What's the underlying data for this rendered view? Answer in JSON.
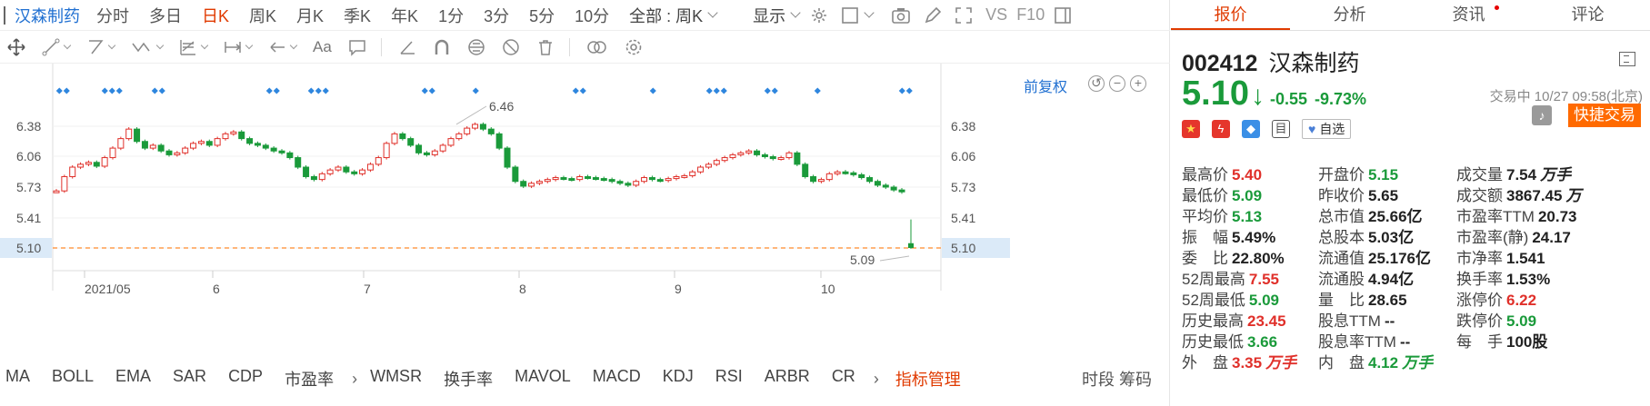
{
  "period_bar": {
    "stock_name": "汉森制药",
    "periods": [
      "分时",
      "多日",
      "日K",
      "周K",
      "月K",
      "季K",
      "年K",
      "1分",
      "3分",
      "5分",
      "10分"
    ],
    "active_period": "日K",
    "all_select": "全部 : 周K",
    "display_select": "显示",
    "vs_label": "VS",
    "f10_label": "F10"
  },
  "toolbar": {
    "text_tool": "Aa"
  },
  "chart": {
    "fuquan": "前复权",
    "y_ticks": [
      "6.38",
      "6.06",
      "5.73",
      "5.41",
      "5.10"
    ],
    "x_labels": [
      "2021/05",
      "6",
      "7",
      "8",
      "9",
      "10"
    ],
    "high_label": "6.46",
    "low_label": "5.09",
    "current_price_label": "5.10",
    "colors": {
      "up": "#e0302a",
      "down": "#1a9a3a",
      "ref_line": "#ff8a2a",
      "marker": "#2e86de"
    }
  },
  "indicators": {
    "left_group": [
      "MA",
      "BOLL",
      "EMA",
      "SAR",
      "CDP",
      "市盈率"
    ],
    "right_group": [
      "WMSR",
      "换手率",
      "MAVOL",
      "MACD",
      "KDJ",
      "RSI",
      "ARBR",
      "CR"
    ],
    "manage": "指标管理",
    "right_tail": "时段 筹码"
  },
  "tabs": [
    "报价",
    "分析",
    "资讯",
    "评论"
  ],
  "active_tab": "报价",
  "quote": {
    "code": "002412",
    "name": "汉森制药",
    "price": "5.10",
    "change": "-0.55",
    "change_pct": "-9.73%",
    "trade_time": "交易中 10/27 09:58(北京)",
    "fav_label": "自选",
    "fast_trade": "快捷交易",
    "doc_badge": "目"
  },
  "stats": [
    [
      {
        "label": "最高价",
        "value": "5.40",
        "color": "red"
      },
      {
        "label": "开盘价",
        "value": "5.15",
        "color": "green"
      },
      {
        "label": "成交量",
        "value": "7.54",
        "unit": "万手"
      }
    ],
    [
      {
        "label": "最低价",
        "value": "5.09",
        "color": "green"
      },
      {
        "label": "昨收价",
        "value": "5.65"
      },
      {
        "label": "成交额",
        "value": "3867.45",
        "unit": "万"
      }
    ],
    [
      {
        "label": "平均价",
        "value": "5.13",
        "color": "green"
      },
      {
        "label": "总市值",
        "value": "25.66亿"
      },
      {
        "label": "市盈率TTM",
        "value": "20.73"
      }
    ],
    [
      {
        "label": "振　幅",
        "value": "5.49%"
      },
      {
        "label": "总股本",
        "value": "5.03亿"
      },
      {
        "label": "市盈率(静)",
        "value": "24.17"
      }
    ],
    [
      {
        "label": "委　比",
        "value": "22.80%"
      },
      {
        "label": "流通值",
        "value": "25.176亿"
      },
      {
        "label": "市净率",
        "value": "1.541"
      }
    ],
    [
      {
        "label": "52周最高",
        "value": "7.55",
        "color": "red"
      },
      {
        "label": "流通股",
        "value": "4.94亿"
      },
      {
        "label": "换手率",
        "value": "1.53%"
      }
    ],
    [
      {
        "label": "52周最低",
        "value": "5.09",
        "color": "green"
      },
      {
        "label": "量　比",
        "value": "28.65"
      },
      {
        "label": "涨停价",
        "value": "6.22",
        "color": "red"
      }
    ],
    [
      {
        "label": "历史最高",
        "value": "23.45",
        "color": "red"
      },
      {
        "label": "股息TTM",
        "value": "--"
      },
      {
        "label": "跌停价",
        "value": "5.09",
        "color": "green"
      }
    ],
    [
      {
        "label": "历史最低",
        "value": "3.66",
        "color": "green"
      },
      {
        "label": "股息率TTM",
        "value": "--"
      },
      {
        "label": "每　手",
        "value": "100股"
      }
    ],
    [
      {
        "label": "外　盘",
        "value": "3.35",
        "unit": "万手",
        "color": "red"
      },
      {
        "label": "内　盘",
        "value": "4.12",
        "unit": "万手",
        "color": "green"
      }
    ]
  ]
}
